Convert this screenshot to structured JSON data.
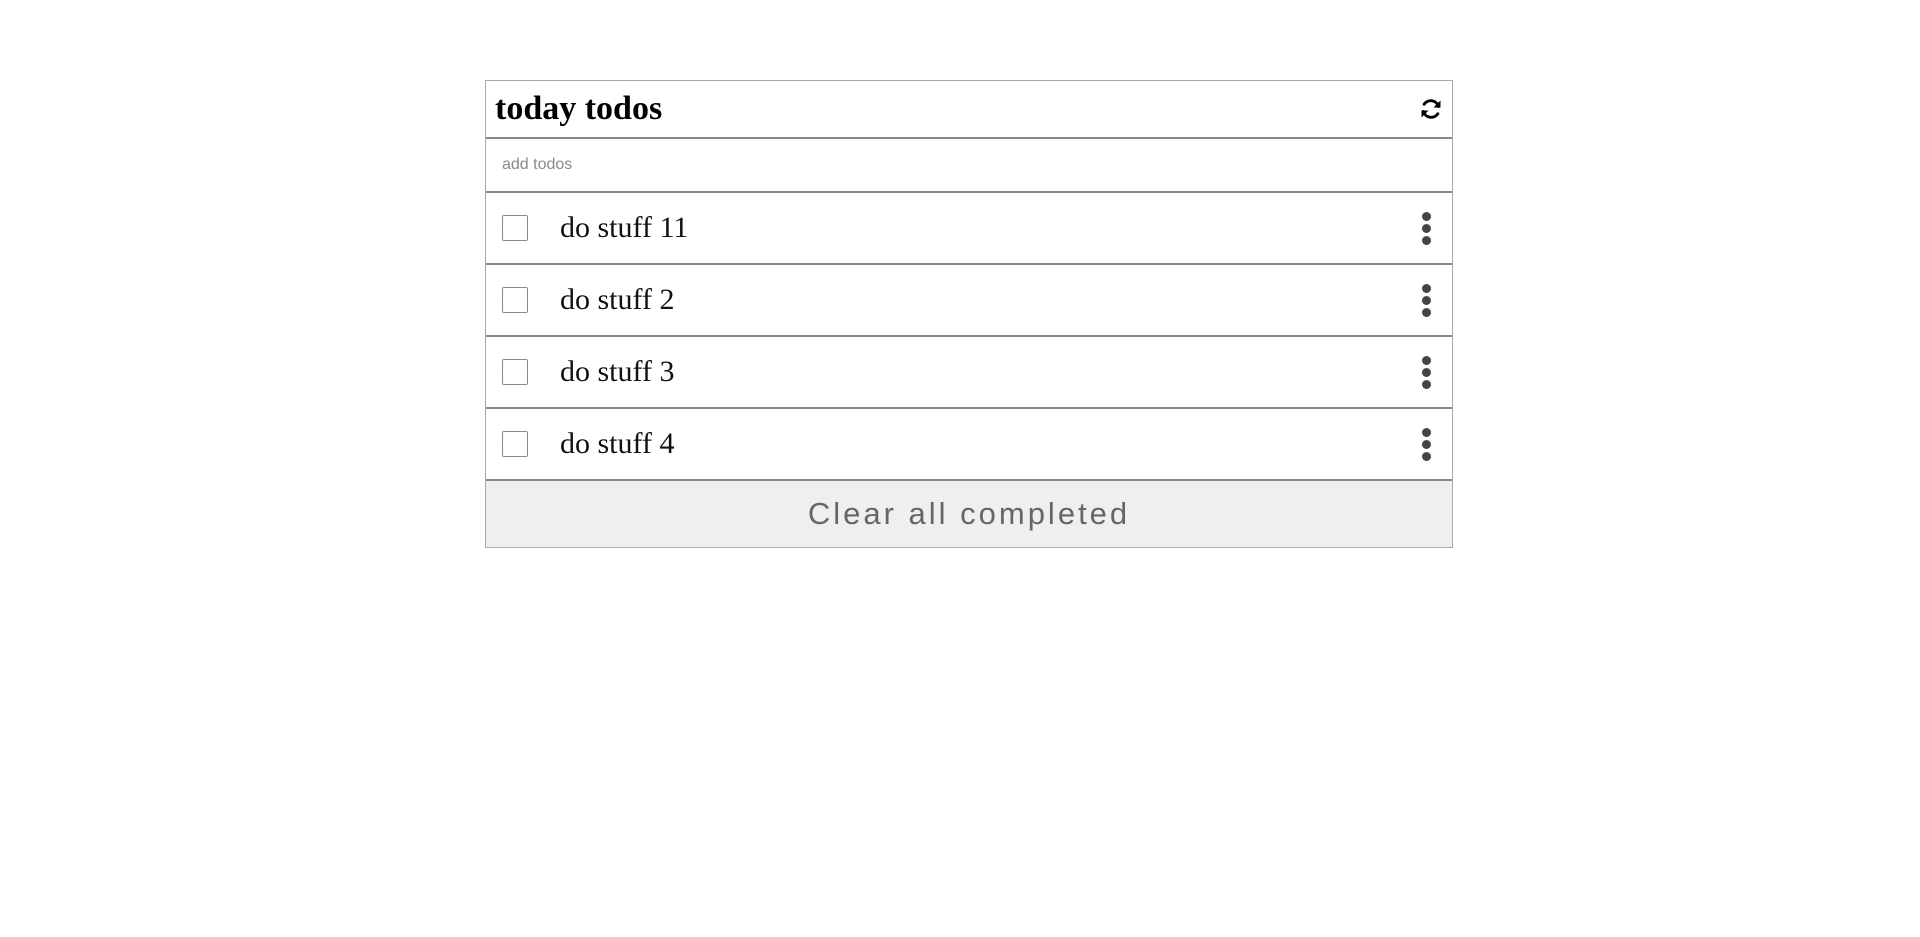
{
  "header": {
    "title": "today todos",
    "refresh_icon": "refresh-icon"
  },
  "add_input": {
    "placeholder": "add todos",
    "value": ""
  },
  "todos": [
    {
      "text": "do stuff 11",
      "completed": false
    },
    {
      "text": "do stuff 2",
      "completed": false
    },
    {
      "text": "do stuff 3",
      "completed": false
    },
    {
      "text": "do stuff 4",
      "completed": false
    }
  ],
  "footer": {
    "clear_label": "Clear all completed"
  },
  "colors": {
    "border": "#888888",
    "button_bg": "#efefef",
    "button_text": "#666666",
    "menu_dots": "#444444"
  }
}
